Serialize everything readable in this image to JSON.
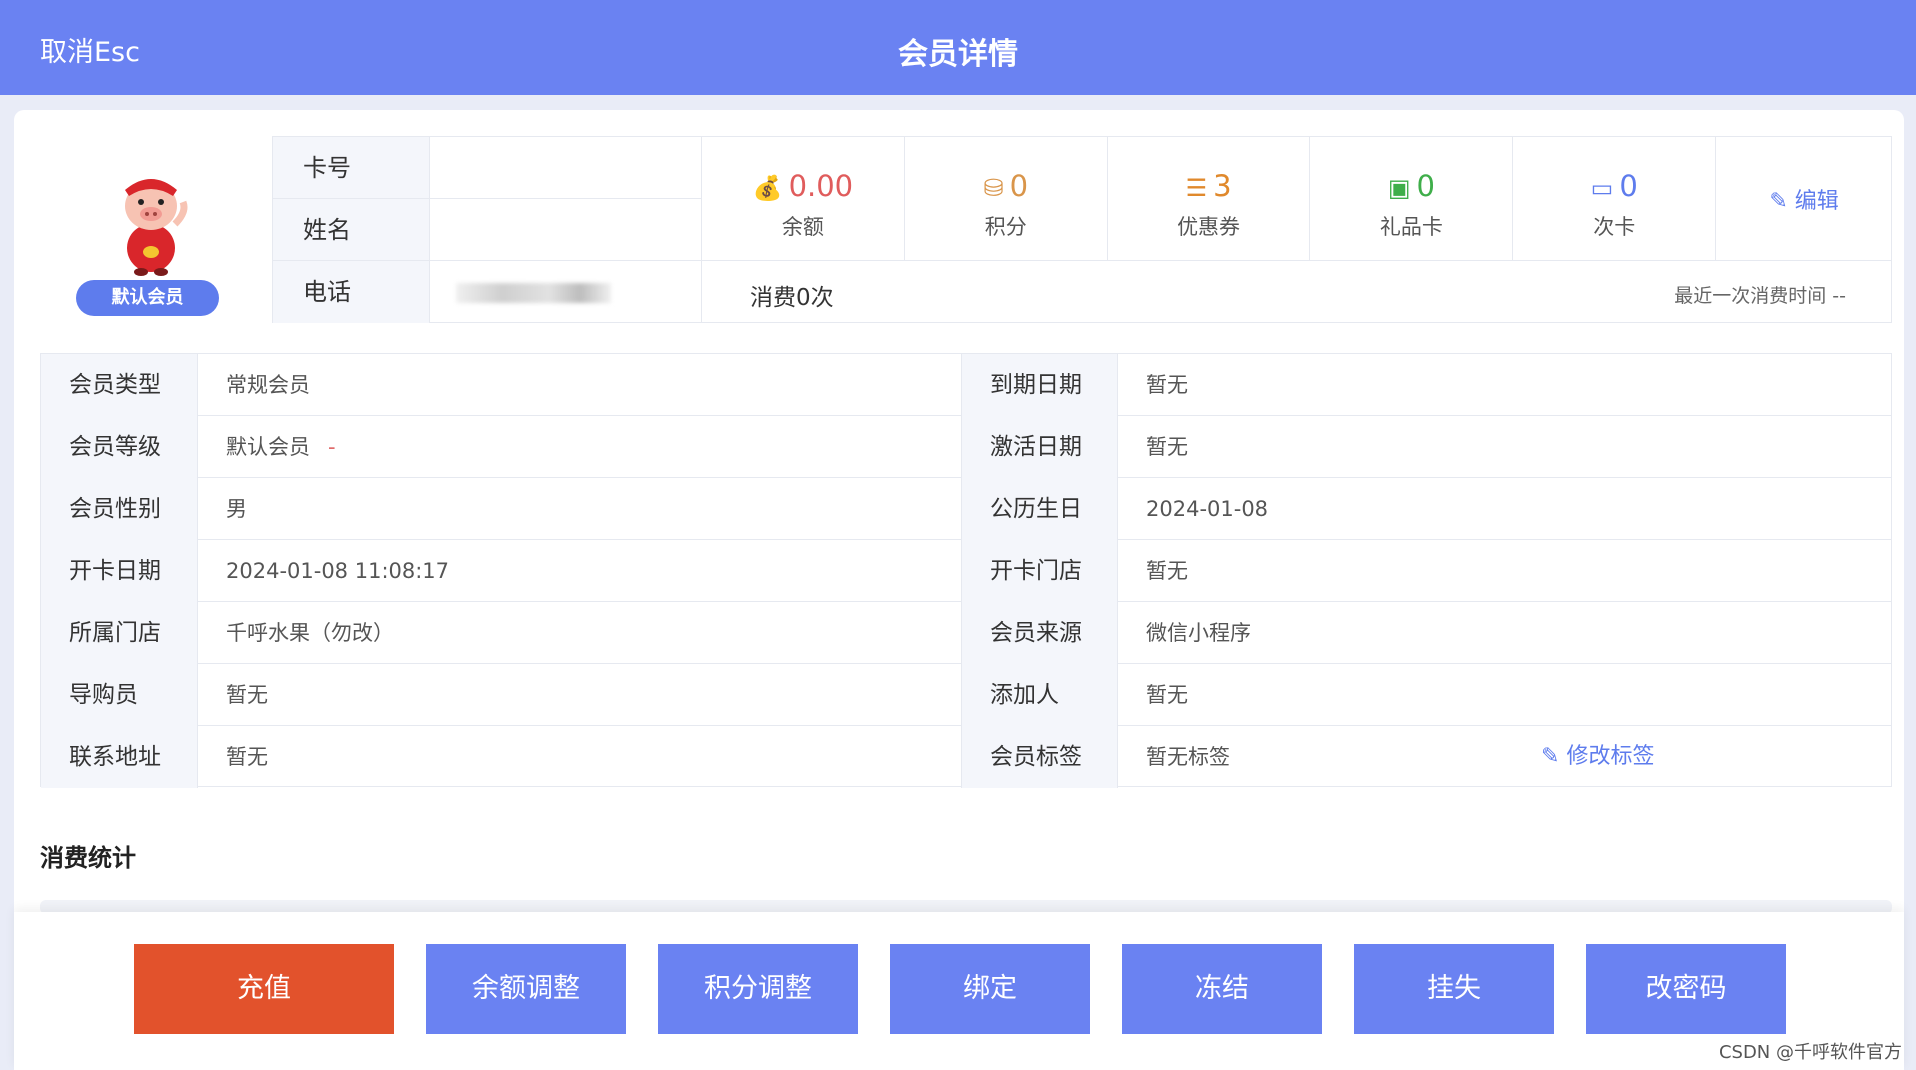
{
  "header": {
    "cancel_label": "取消Esc",
    "title": "会员详情"
  },
  "profile": {
    "badge": "默认会员",
    "avatar_icon": "pig-mascot-icon"
  },
  "basic": {
    "card_no_label": "卡号",
    "card_no": "",
    "name_label": "姓名",
    "name": "",
    "phone_label": "电话"
  },
  "stats": [
    {
      "value": "0.00",
      "label": "余额",
      "icon": "money-bag-icon",
      "color": "#e05c5c"
    },
    {
      "value": "0",
      "label": "积分",
      "icon": "coins-icon",
      "color": "#d9954a"
    },
    {
      "value": "3",
      "label": "优惠券",
      "icon": "ticket-icon",
      "color": "#e0892c"
    },
    {
      "value": "0",
      "label": "礼品卡",
      "icon": "gift-card-icon",
      "color": "#3fae4a"
    },
    {
      "value": "0",
      "label": "次卡",
      "icon": "card-icon",
      "color": "#5e7ced"
    }
  ],
  "edit_label": "编辑",
  "consume": {
    "count": "消费0次",
    "last_time": "最近一次消费时间 --"
  },
  "details": [
    {
      "l1": "会员类型",
      "v1": "常规会员",
      "l2": "到期日期",
      "v2": "暂无"
    },
    {
      "l1": "会员等级",
      "v1": "默认会员",
      "l2": "激活日期",
      "v2": "暂无"
    },
    {
      "l1": "会员性别",
      "v1": "男",
      "l2": "公历生日",
      "v2": "2024-01-08"
    },
    {
      "l1": "开卡日期",
      "v1": "2024-01-08 11:08:17",
      "l2": "开卡门店",
      "v2": "暂无"
    },
    {
      "l1": "所属门店",
      "v1": "千呼水果（勿改）",
      "l2": "会员来源",
      "v2": "微信小程序"
    },
    {
      "l1": "导购员",
      "v1": "暂无",
      "l2": "添加人",
      "v2": "暂无"
    },
    {
      "l1": "联系地址",
      "v1": "暂无",
      "l2": "会员标签",
      "v2": "暂无标签"
    }
  ],
  "level_dash": "-",
  "modify_tag_label": "修改标签",
  "section_title": "消费统计",
  "actions": {
    "recharge": "充值",
    "balance_adjust": "余额调整",
    "points_adjust": "积分调整",
    "bind": "绑定",
    "freeze": "冻结",
    "report_loss": "挂失",
    "change_password": "改密码"
  },
  "watermark": "CSDN @千呼软件官方",
  "colors": {
    "header": "#6a82f2",
    "primary_button": "#e2522c",
    "accent": "#5e7ced"
  }
}
